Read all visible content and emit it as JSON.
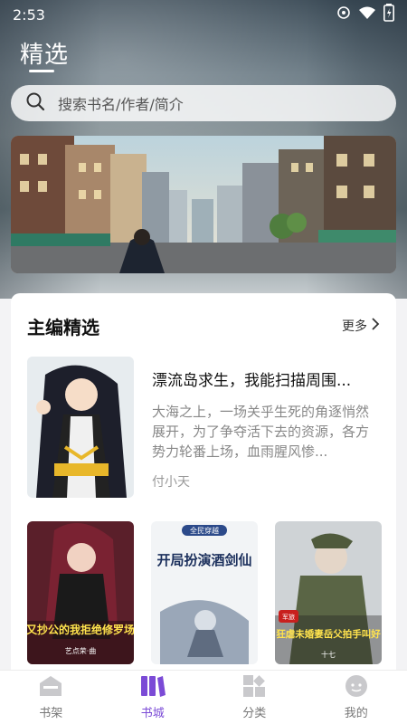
{
  "status": {
    "time": "2:53"
  },
  "header": {
    "title": "精选"
  },
  "search": {
    "placeholder": "搜索书名/作者/简介"
  },
  "section": {
    "title": "主编精选",
    "more_label": "更多"
  },
  "featured": {
    "title": "漂流岛求生，我能扫描周围...",
    "description": "大海之上，一场关乎生死的角逐悄然展开，为了争夺活下去的资源，各方势力轮番上场，血雨腥风惨...",
    "author": "付小天"
  },
  "books": [
    {
      "cover_title": "又抄公的我拒绝修罗场",
      "cover_author": "艺点荣·曲"
    },
    {
      "cover_title": "开局扮演酒剑仙",
      "cover_badge": "全民穿越"
    },
    {
      "cover_title": "狂虐未婚妻岳父拍手叫好",
      "cover_badge": "军旅",
      "cover_author": "十七"
    }
  ],
  "tabs": [
    {
      "label": "书架",
      "icon": "bookshelf-icon",
      "active": false
    },
    {
      "label": "书城",
      "icon": "bookstore-icon",
      "active": true
    },
    {
      "label": "分类",
      "icon": "category-icon",
      "active": false
    },
    {
      "label": "我的",
      "icon": "profile-icon",
      "active": false
    }
  ],
  "colors": {
    "accent": "#7b4bd6"
  }
}
